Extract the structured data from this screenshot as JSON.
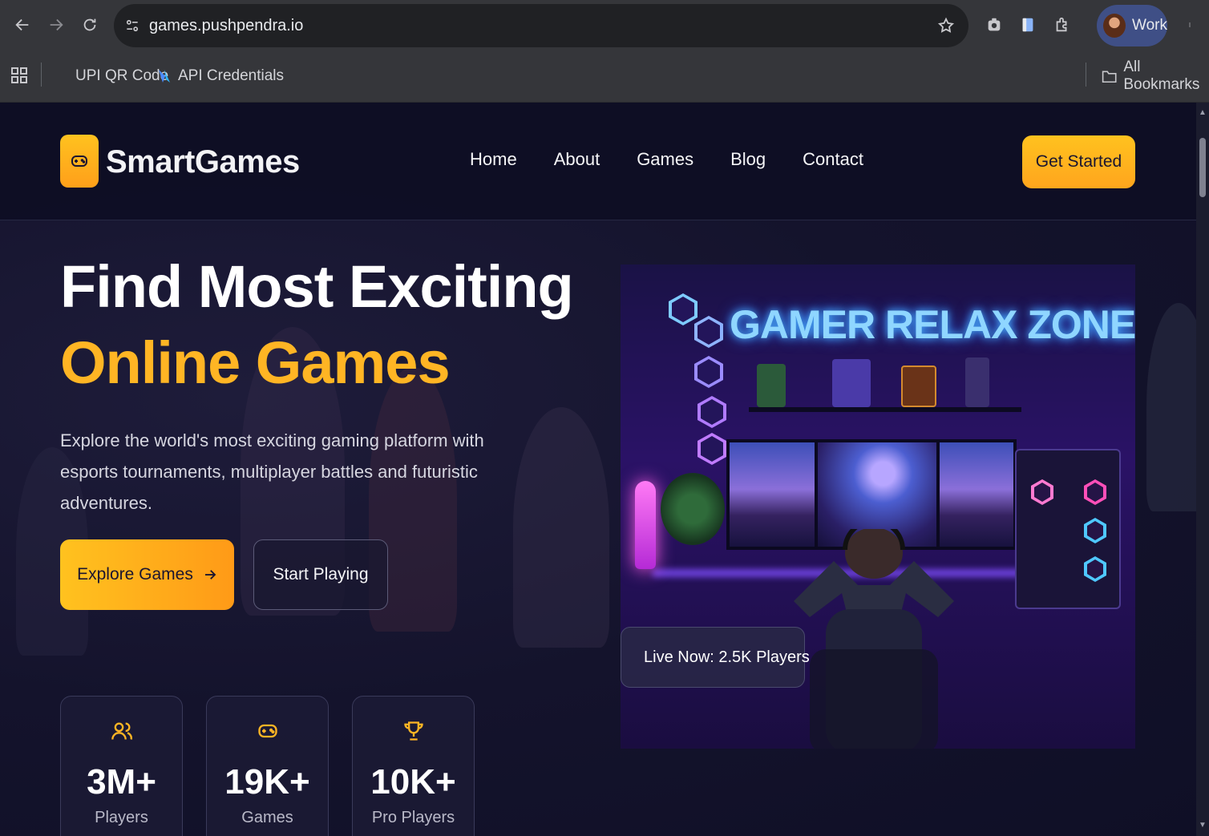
{
  "browser": {
    "url": "games.pushpendra.io",
    "profile_label": "Work",
    "bookmarks": [
      {
        "label": "UPI QR Code"
      },
      {
        "label": "API Credentials"
      }
    ],
    "all_bookmarks_label": "All Bookmarks"
  },
  "site": {
    "logo_text": "SmartGames",
    "nav": [
      {
        "label": "Home"
      },
      {
        "label": "About"
      },
      {
        "label": "Games"
      },
      {
        "label": "Blog"
      },
      {
        "label": "Contact"
      }
    ],
    "cta_label": "Get Started"
  },
  "hero": {
    "title_line1": "Find Most Exciting",
    "title_line2": "Online Games",
    "description": "Explore the world's most exciting gaming platform with esports tournaments, multiplayer battles and futuristic adventures.",
    "primary_button": "Explore Games",
    "secondary_button": "Start Playing",
    "image_title": "GAMER RELAX ZONE",
    "live_badge": "Live Now: 2.5K Players"
  },
  "stats": [
    {
      "icon": "users-icon",
      "value": "3M+",
      "label": "Players"
    },
    {
      "icon": "gamepad-icon",
      "value": "19K+",
      "label": "Games"
    },
    {
      "icon": "trophy-icon",
      "value": "10K+",
      "label": "Pro Players"
    }
  ],
  "colors": {
    "accent": "#ffb524",
    "background": "#0f1024",
    "chrome": "#35363a"
  }
}
